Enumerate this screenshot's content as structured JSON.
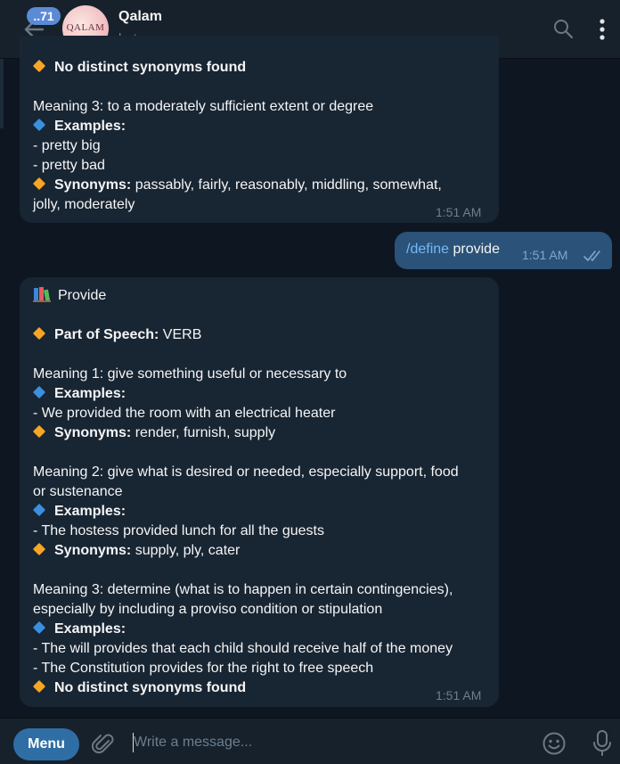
{
  "header": {
    "unread_badge": "..71",
    "avatar_text": "QALAM",
    "title": "Qalam",
    "subtitle": "bot"
  },
  "messages": {
    "first": {
      "no_syn": "No distinct synonyms found",
      "meaning3": "Meaning 3: to a moderately sufficient extent or degree",
      "examples_label": "Examples:",
      "ex1": "- pretty big",
      "ex2": "- pretty bad",
      "synonyms_label": "Synonyms:",
      "synonyms_line1": " passably, fairly, reasonably, middling, somewhat,",
      "synonyms_line2": "jolly, moderately",
      "time": "1:51 AM"
    },
    "outgoing": {
      "command": "/define",
      "word": " provide",
      "time": "1:51 AM"
    },
    "reply": {
      "title": "Provide",
      "pos_label": "Part of Speech:",
      "pos_value": " VERB",
      "m1": "Meaning 1: give something useful or necessary to",
      "m1_examples_label": "Examples:",
      "m1_ex1": "- We provided the room with an electrical heater",
      "m1_syn_label": "Synonyms:",
      "m1_syn": " render, furnish, supply",
      "m2_line1": "Meaning 2: give what is desired or needed, especially support, food",
      "m2_line2": "or sustenance",
      "m2_examples_label": "Examples:",
      "m2_ex1": "- The hostess provided lunch for all the guests",
      "m2_syn_label": "Synonyms:",
      "m2_syn": " supply, ply, cater",
      "m3_line1": "Meaning 3: determine (what is to happen in certain contingencies),",
      "m3_line2": "especially by including a proviso condition or stipulation",
      "m3_examples_label": "Examples:",
      "m3_ex1": "- The will provides that each child should receive half of the money",
      "m3_ex2": "- The Constitution provides for the right to free speech",
      "m3_no_syn": "No distinct synonyms found",
      "time": "1:51 AM"
    }
  },
  "composer": {
    "menu_label": "Menu",
    "placeholder": "Write a message..."
  },
  "colors": {
    "background": "#0e1621",
    "incoming_bubble": "#182533",
    "outgoing_bubble": "#2b5278",
    "accent": "#2f6ea5",
    "command_link": "#71baf7"
  },
  "icons": {
    "back": "arrow-left-icon",
    "search": "search-icon",
    "more": "more-vertical-icon",
    "attach": "paperclip-icon",
    "emoji": "smiley-icon",
    "mic": "microphone-icon",
    "read": "double-check-icon",
    "bullet_orange": "orange-diamond-icon",
    "bullet_blue": "blue-diamond-icon",
    "books": "books-icon"
  }
}
